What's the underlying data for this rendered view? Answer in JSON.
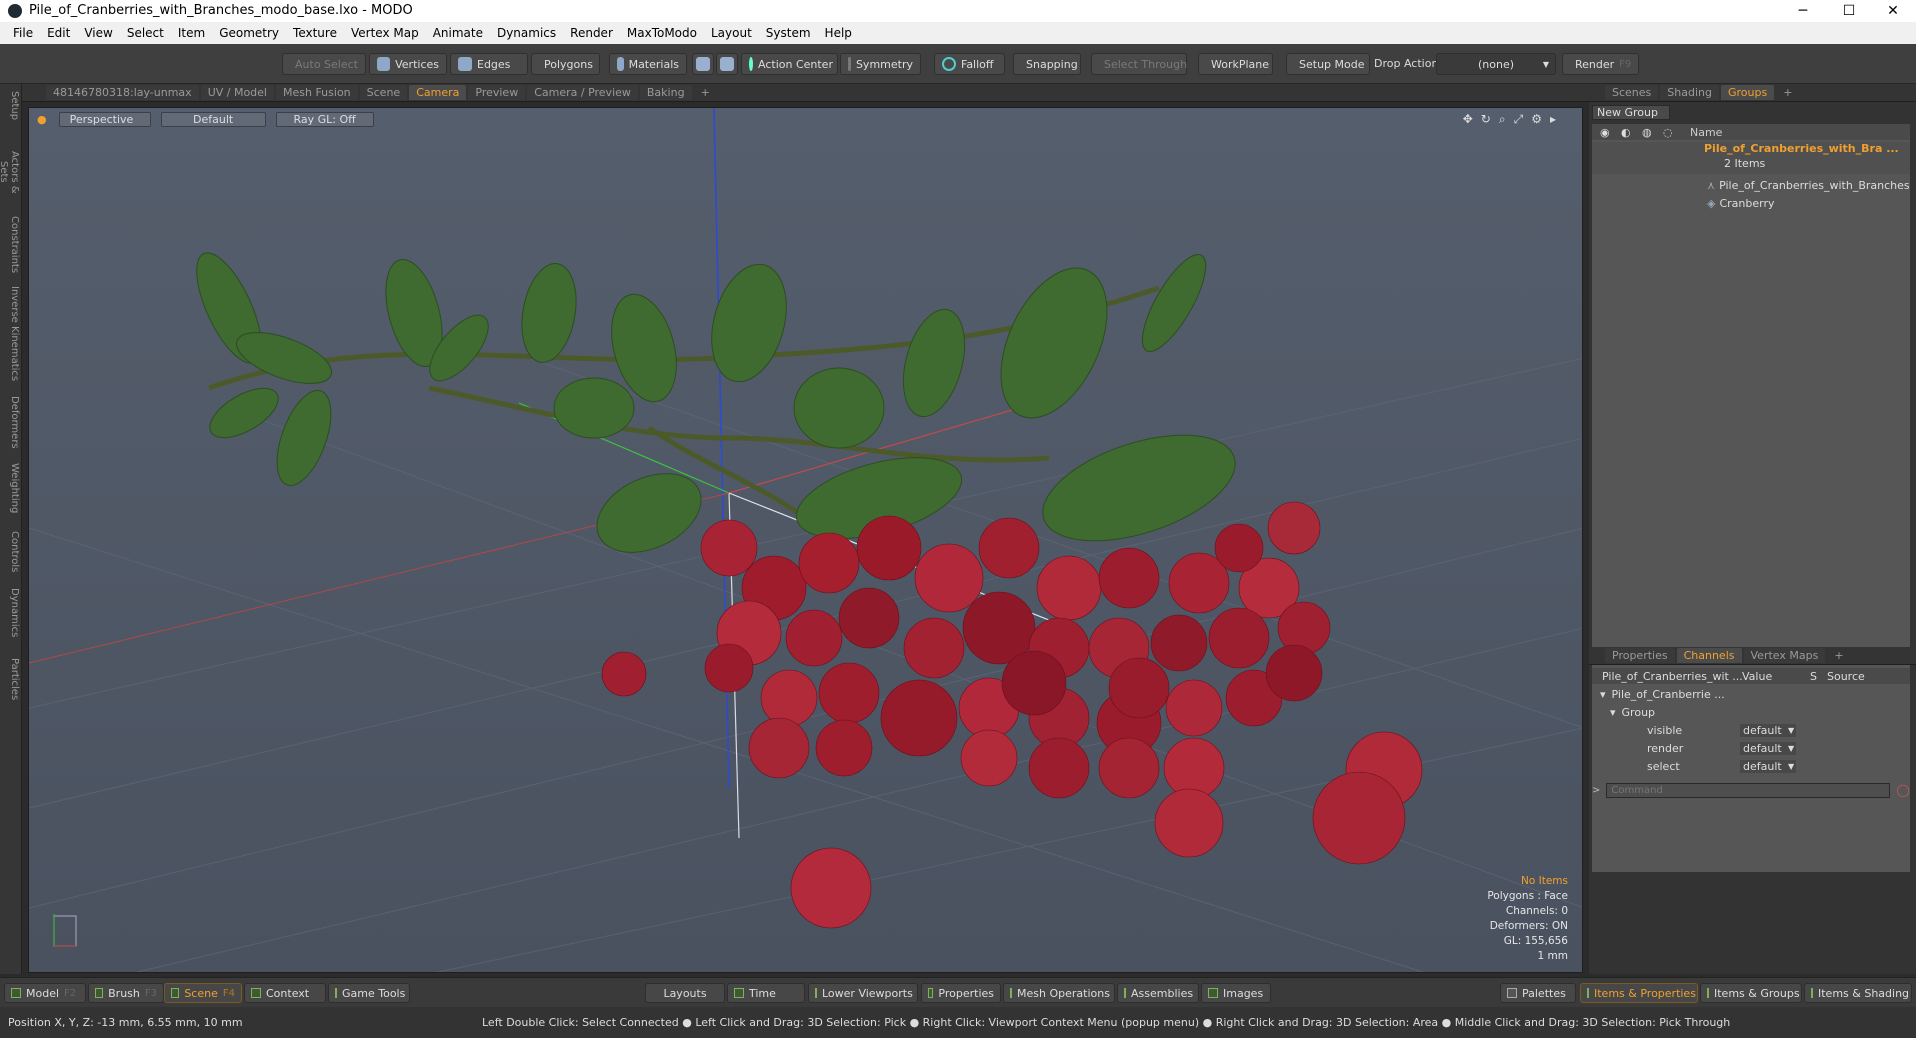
{
  "window": {
    "title": "Pile_of_Cranberries_with_Branches_modo_base.lxo - MODO",
    "minimize": "─",
    "maximize": "☐",
    "close": "✕"
  },
  "menu": [
    "File",
    "Edit",
    "View",
    "Select",
    "Item",
    "Geometry",
    "Texture",
    "Vertex Map",
    "Animate",
    "Dynamics",
    "Render",
    "MaxToModo",
    "Layout",
    "System",
    "Help"
  ],
  "toolbar": {
    "auto_select": "Auto Select",
    "vertices": "Vertices",
    "edges": "Edges",
    "polygons": "Polygons",
    "materials": "Materials",
    "action_center": "Action Center",
    "symmetry": "Symmetry",
    "falloff": "Falloff",
    "snapping": "Snapping",
    "select_through": "Select Through",
    "workplane": "WorkPlane",
    "setup_mode": "Setup Mode",
    "drop_action": "Drop Action",
    "drop_value": "(none)",
    "render": "Render",
    "render_key": "F9"
  },
  "viewport_tabs": [
    "48146780318:lay-unmax",
    "UV / Model",
    "Mesh Fusion",
    "Scene",
    "Camera",
    "Preview",
    "Camera / Preview",
    "Baking",
    "+"
  ],
  "left_tabs": [
    "Setup",
    "Actors & Sets",
    "Constraints",
    "Inverse Kinematics",
    "Deformers",
    "Weighting",
    "Controls",
    "Dynamics",
    "Particles"
  ],
  "viewport": {
    "view": "Perspective",
    "shading": "Default",
    "raygl": "Ray GL: Off",
    "info": {
      "items": "No Items",
      "polygons": "Polygons : Face",
      "channels": "Channels: 0",
      "deformers": "Deformers: ON",
      "gl": "GL: 155,656",
      "scale": "1 mm"
    }
  },
  "right_top_tabs": [
    "Scenes",
    "Shading",
    "Groups",
    "+"
  ],
  "groups": {
    "new_group": "New Group",
    "col_name": "Name",
    "group_name": "Pile_of_Cranberries_with_Bra ...",
    "group_count": "2 Items",
    "children": [
      "Pile_of_Cranberries_with_Branches",
      "Cranberry"
    ]
  },
  "right_bottom_tabs": [
    "Properties",
    "Channels",
    "Vertex Maps",
    "+"
  ],
  "channels": {
    "col_item": "Pile_of_Cranberries_wit ...",
    "col_value": "Value",
    "col_s": "S",
    "col_source": "Source",
    "item": "Pile_of_Cranberrie ...",
    "group": "Group",
    "rows": [
      {
        "name": "visible",
        "value": "default"
      },
      {
        "name": "render",
        "value": "default"
      },
      {
        "name": "select",
        "value": "default"
      }
    ],
    "command_placeholder": "Command"
  },
  "bottom_bar": {
    "model": "Model",
    "model_key": "F2",
    "brush": "Brush",
    "brush_key": "F3",
    "scene": "Scene",
    "scene_key": "F4",
    "context": "Context",
    "game_tools": "Game Tools",
    "layouts": "Layouts",
    "time": "Time",
    "lower_viewports": "Lower Viewports",
    "properties": "Properties",
    "mesh_operations": "Mesh Operations",
    "assemblies": "Assemblies",
    "images": "Images",
    "palettes": "Palettes",
    "items_properties": "Items & Properties",
    "items_groups": "Items & Groups",
    "items_shading": "Items & Shading"
  },
  "status": {
    "position": "Position X, Y, Z:   -13 mm, 6.55 mm, 10 mm",
    "hints": "Left Double Click: Select Connected ● Left Click and Drag: 3D Selection: Pick ● Right Click: Viewport Context Menu (popup menu) ● Right Click and Drag: 3D Selection: Area ● Middle Click and Drag: 3D Selection: Pick Through"
  }
}
